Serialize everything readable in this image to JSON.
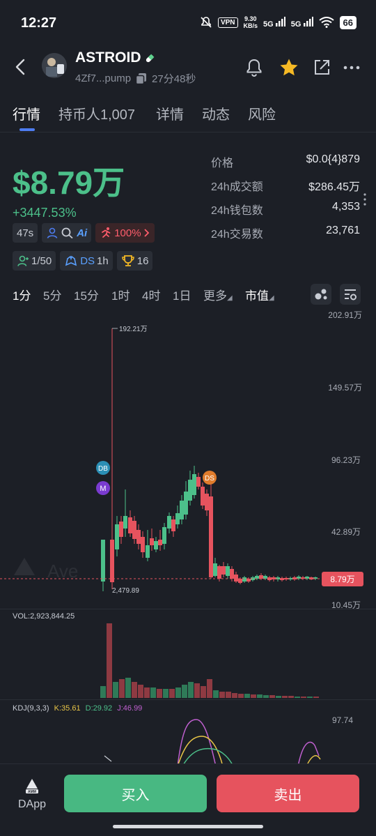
{
  "status": {
    "time": "12:27",
    "vpn": "VPN",
    "speed_top": "9.30",
    "speed_bottom": "KB/s",
    "net1": "5G",
    "net2": "5G",
    "battery": "66"
  },
  "token": {
    "name": "ASTROID",
    "address": "4Zf7...pump",
    "age": "27分48秒"
  },
  "tabs": [
    "行情",
    "持币人1,007",
    "详情",
    "动态",
    "风险"
  ],
  "market": {
    "cap": "$8.79万",
    "change": "+3447.53%",
    "stats": [
      {
        "label": "价格",
        "value": "$0.0{4}879"
      },
      {
        "label": "24h成交额",
        "value": "$286.45万"
      },
      {
        "label": "24h钱包数",
        "value": "4,353"
      },
      {
        "label": "24h交易数",
        "value": "23,761"
      }
    ]
  },
  "badges": {
    "time": "47s",
    "ai": "Ai",
    "progress": "100%",
    "holders": "1/50",
    "ds": "DS",
    "ds_time": "1h",
    "trophy": "16"
  },
  "intervals": [
    "1分",
    "5分",
    "15分",
    "1时",
    "4时",
    "1日",
    "更多",
    "市值"
  ],
  "chart": {
    "y_labels": [
      "202.91万",
      "149.57万",
      "96.23万",
      "42.89万",
      "10.45万"
    ],
    "max_label": "192.21万",
    "min_label": "2,479.89",
    "current": "8.79万",
    "markers": [
      "DB",
      "M",
      "DS"
    ],
    "watermark": "Ave"
  },
  "volume": {
    "label": "VOL:2,923,844.25"
  },
  "kdj": {
    "label": "KDJ(9,3,3)",
    "k": "K:35.61",
    "d": "D:29.92",
    "j": "J:46.99",
    "max": "97.74"
  },
  "bottom": {
    "dapp": "DApp",
    "amm": "AMM",
    "buy": "买入",
    "sell": "卖出"
  },
  "colors": {
    "up": "#4cc08a",
    "down": "#e6535e",
    "accent": "#4d7cf0"
  }
}
